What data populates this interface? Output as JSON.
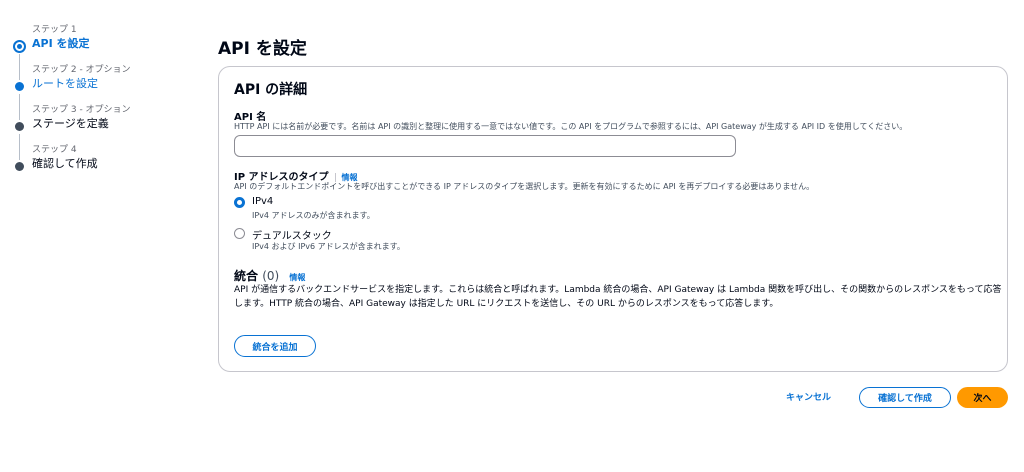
{
  "stepper": {
    "steps": [
      {
        "num": "ステップ 1",
        "title": "API を設定"
      },
      {
        "num": "ステップ 2 - オプション",
        "title": "ルートを設定"
      },
      {
        "num": "ステップ 3 - オプション",
        "title": "ステージを定義"
      },
      {
        "num": "ステップ 4",
        "title": "確認して作成"
      }
    ]
  },
  "page": {
    "title": "API を設定"
  },
  "panel": {
    "title": "API の詳細",
    "api_name": {
      "label": "API 名",
      "description": "HTTP API には名前が必要です。名前は API の識別と整理に使用する一意ではない値です。この API をプログラムで参照するには、API Gateway が生成する API ID を使用してください。",
      "value": ""
    },
    "ip_type": {
      "label": "IP アドレスのタイプ",
      "info": "情報",
      "description": "API のデフォルトエンドポイントを呼び出すことができる IP アドレスのタイプを選択します。更新を有効にするために API を再デプロイする必要はありません。",
      "options": [
        {
          "label": "IPv4",
          "description": "IPv4 アドレスのみが含まれます。",
          "checked": true
        },
        {
          "label": "デュアルスタック",
          "description": "IPv4 および IPv6 アドレスが含まれます。",
          "checked": false
        }
      ]
    },
    "integrations": {
      "title": "統合",
      "count": "(0)",
      "info": "情報",
      "description": "API が通信するバックエンドサービスを指定します。これらは統合と呼ばれます。Lambda 統合の場合、API Gateway は Lambda 関数を呼び出し、その関数からのレスポンスをもって応答します。HTTP 統合の場合、API Gateway は指定した URL にリクエストを送信し、その URL からのレスポンスをもって応答します。",
      "add_button": "統合を追加"
    }
  },
  "footer": {
    "cancel": "キャンセル",
    "confirm": "確認して作成",
    "next": "次へ"
  },
  "colors": {
    "accent": "#0972d3",
    "primary_button": "#ff9900"
  }
}
